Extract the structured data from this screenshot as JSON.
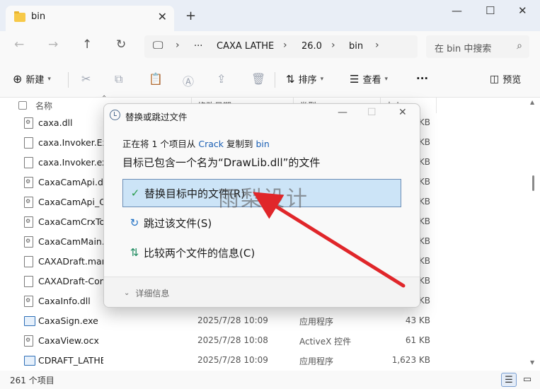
{
  "window": {
    "tab_title": "bin",
    "close_tab": "✕",
    "new_tab": "+",
    "minimize": "—",
    "maximize": "☐",
    "close": "✕"
  },
  "address": {
    "computer_icon": "monitor-icon",
    "ellipsis": "···",
    "parts": [
      "CAXA LATHE",
      "26.0",
      "bin"
    ],
    "separator": "›",
    "search_placeholder": "在 bin 中搜索"
  },
  "toolbar": {
    "new_label": "新建",
    "sort_label": "排序",
    "view_label": "查看",
    "more_label": "···",
    "preview_label": "预览"
  },
  "columns": {
    "name": "名称",
    "date": "修改日期",
    "type": "类型",
    "size": "大小"
  },
  "files": [
    {
      "name": "caxa.dll",
      "date": "",
      "type": "",
      "size": "KB",
      "icon": "gear"
    },
    {
      "name": "caxa.Invoker.Ex",
      "date": "",
      "type": "",
      "size": "KB",
      "icon": "doc"
    },
    {
      "name": "caxa.Invoker.exe",
      "date": "",
      "type": "",
      "size": "KB",
      "icon": "doc"
    },
    {
      "name": "CaxaCamApi.dll",
      "date": "",
      "type": "",
      "size": "KB",
      "icon": "gear"
    },
    {
      "name": "CaxaCamApi_CP",
      "date": "",
      "type": "",
      "size": "KB",
      "icon": "gear"
    },
    {
      "name": "CaxaCamCrxToc",
      "date": "",
      "type": "",
      "size": "KB",
      "icon": "gear"
    },
    {
      "name": "CaxaCamMain.d",
      "date": "",
      "type": "",
      "size": "KB",
      "icon": "gear"
    },
    {
      "name": "CAXADraft.mani",
      "date": "",
      "type": "",
      "size": "KB",
      "icon": "doc"
    },
    {
      "name": "CAXADraft-Com",
      "date": "",
      "type": "",
      "size": "KB",
      "icon": "doc"
    },
    {
      "name": "CaxaInfo.dll",
      "date": "",
      "type": "",
      "size": "KB",
      "icon": "gear"
    },
    {
      "name": "CaxaSign.exe",
      "date": "2025/7/28 10:09",
      "type": "应用程序",
      "size": "43 KB",
      "icon": "exe"
    },
    {
      "name": "CaxaView.ocx",
      "date": "2025/7/28 10:08",
      "type": "ActiveX 控件",
      "size": "61 KB",
      "icon": "gear"
    },
    {
      "name": "CDRAFT_LATHE.exe",
      "date": "2025/7/28 10:09",
      "type": "应用程序",
      "size": "1,623 KB",
      "icon": "exe"
    }
  ],
  "status": {
    "count": "261 个项目"
  },
  "dialog": {
    "title": "替换或跳过文件",
    "line_prefix": "正在将 1 个项目从 ",
    "source": "Crack",
    "line_mid": " 复制到 ",
    "target": "bin",
    "heading": "目标已包含一个名为“DrawLib.dll”的文件",
    "options": [
      {
        "label": "替换目标中的文件(R)",
        "icon": "✓"
      },
      {
        "label": "跳过该文件(S)",
        "icon": "↻"
      },
      {
        "label": "比较两个文件的信息(C)",
        "icon": "⇅"
      }
    ],
    "details": "详细信息",
    "watermark": "雨梨设计"
  },
  "colors": {
    "accent": "#1a5fb4",
    "selected_option_bg": "#cce4f7",
    "arrow": "#e0262a"
  }
}
